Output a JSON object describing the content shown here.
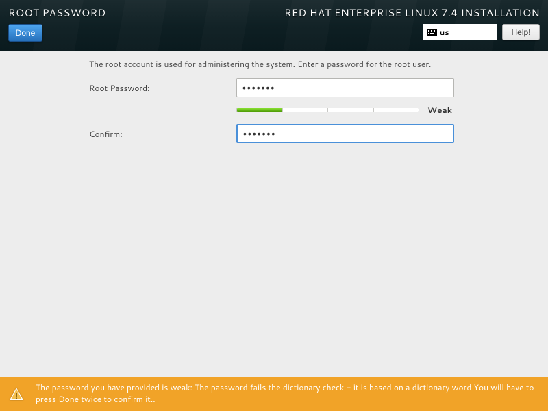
{
  "header": {
    "page_title": "ROOT PASSWORD",
    "installer_title": "RED HAT ENTERPRISE LINUX 7.4 INSTALLATION",
    "done_label": "Done",
    "help_label": "Help!",
    "keyboard_layout": "us"
  },
  "form": {
    "instruction": "The root account is used for administering the system.  Enter a password for the root user.",
    "root_password_label": "Root Password:",
    "confirm_label": "Confirm:",
    "root_password_value": "•••••••",
    "confirm_value": "•••••••",
    "strength": {
      "label": "Weak",
      "segments_filled": 1,
      "segments_total": 4
    }
  },
  "warning": {
    "text": "The password you have provided is weak: The password fails the dictionary check - it is based on a dictionary word You will have to press Done twice to confirm it.."
  },
  "colors": {
    "header_bg": "#0e1f23",
    "accent_blue": "#2f7fd1",
    "warning_bg": "#f1a328",
    "body_bg": "#ededed"
  }
}
